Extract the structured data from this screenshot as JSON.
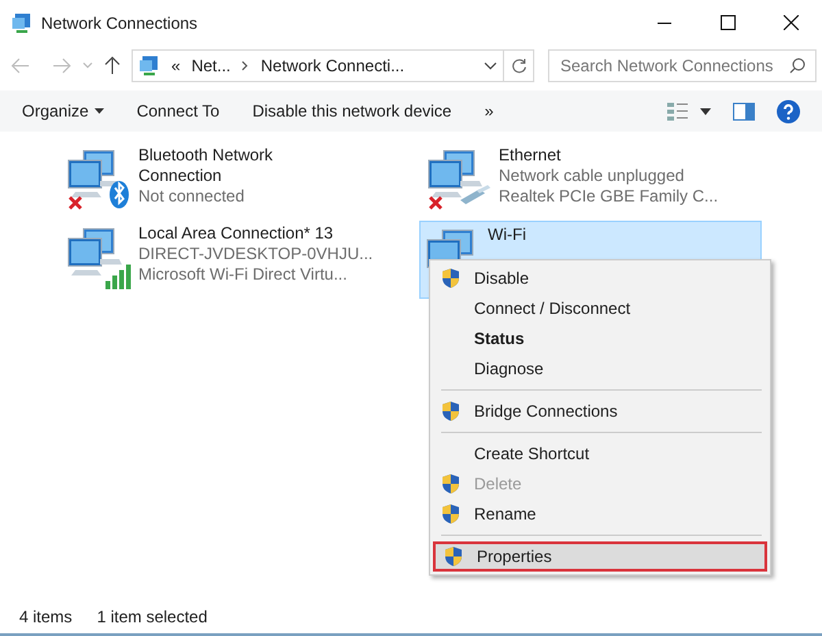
{
  "window": {
    "title": "Network Connections"
  },
  "address": {
    "crumbs": [
      "«",
      "Net...",
      "Network Connecti..."
    ],
    "search_placeholder": "Search Network Connections"
  },
  "toolbar": {
    "buttons": [
      {
        "label": "Organize",
        "dropdown": true
      },
      {
        "label": "Connect To",
        "dropdown": false
      },
      {
        "label": "Disable this network device",
        "dropdown": false
      }
    ],
    "overflow": "»"
  },
  "connections": [
    {
      "name": "Bluetooth Network Connection",
      "lines": [
        "Not connected"
      ],
      "kind": "bluetooth",
      "connected": false,
      "selected": false
    },
    {
      "name": "Ethernet",
      "lines": [
        "Network cable unplugged",
        "Realtek PCIe GBE Family C..."
      ],
      "kind": "ethernet",
      "connected": false,
      "selected": false
    },
    {
      "name": "Local Area Connection* 13",
      "lines": [
        "DIRECT-JVDESKTOP-0VHJU...",
        "Microsoft Wi-Fi Direct Virtu..."
      ],
      "kind": "wireless",
      "connected": true,
      "selected": false
    },
    {
      "name": "Wi-Fi",
      "kind": "plain",
      "connected": true,
      "selected": true
    }
  ],
  "context_menu": [
    {
      "kind": "item",
      "label": "Disable",
      "shield": true,
      "bold": false,
      "disabled": false,
      "highlighted": false
    },
    {
      "kind": "item",
      "label": "Connect / Disconnect",
      "shield": false,
      "bold": false,
      "disabled": false,
      "highlighted": false
    },
    {
      "kind": "item",
      "label": "Status",
      "shield": false,
      "bold": true,
      "disabled": false,
      "highlighted": false
    },
    {
      "kind": "item",
      "label": "Diagnose",
      "shield": false,
      "bold": false,
      "disabled": false,
      "highlighted": false
    },
    {
      "kind": "separator"
    },
    {
      "kind": "item",
      "label": "Bridge Connections",
      "shield": true,
      "bold": false,
      "disabled": false,
      "highlighted": false
    },
    {
      "kind": "separator"
    },
    {
      "kind": "item",
      "label": "Create Shortcut",
      "shield": false,
      "bold": false,
      "disabled": false,
      "highlighted": false
    },
    {
      "kind": "item",
      "label": "Delete",
      "shield": true,
      "bold": false,
      "disabled": true,
      "highlighted": false
    },
    {
      "kind": "item",
      "label": "Rename",
      "shield": true,
      "bold": false,
      "disabled": false,
      "highlighted": false
    },
    {
      "kind": "separator"
    },
    {
      "kind": "item",
      "label": "Properties",
      "shield": true,
      "bold": false,
      "disabled": false,
      "highlighted": true
    }
  ],
  "status_bar": [
    "4 items",
    "1 item selected"
  ]
}
